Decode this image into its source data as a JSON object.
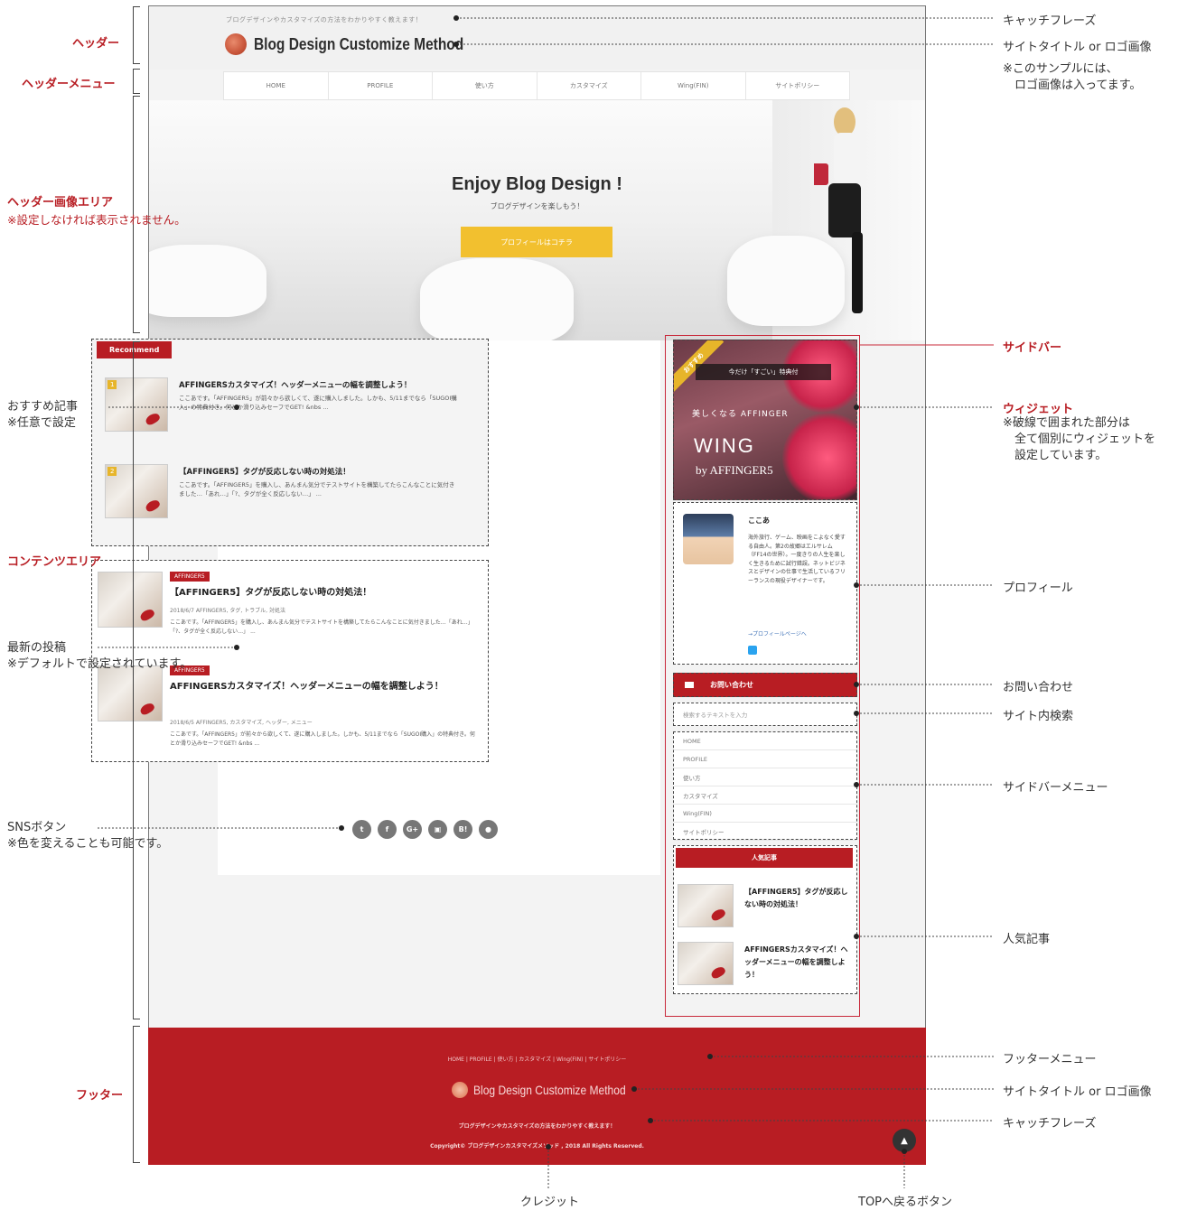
{
  "mock": {
    "catchphrase": "ブログデザインやカスタマイズの方法をわかりやすく教えます！",
    "site_title": "Blog Design Customize Method",
    "nav": [
      "HOME",
      "PROFILE",
      "使い方",
      "カスタマイズ",
      "Wing(FIN)",
      "サイトポリシー"
    ],
    "hero": {
      "title": "Enjoy Blog Design !",
      "subtitle": "ブログデザインを楽しもう！",
      "button": "プロフィールはコチラ"
    },
    "recommend": {
      "label": "Recommend",
      "items": [
        {
          "badge": "1",
          "title": "AFFINGERSカスタマイズ！ヘッダーメニューの幅を調整しよう！",
          "excerpt": "ここあです。「AFFINGER5」が前々から欲しくて、遂に購入しました。しかも、5/11までなら「SUGOI購入」の特典付き。何とか滑り込みセーフでGET! &nbs ..."
        },
        {
          "badge": "2",
          "title": "【AFFINGER5】タグが反応しない時の対処法！",
          "excerpt": "ここあです。「AFFINGER5」を購入し、あんまん気分でテストサイトを構築してたらこんなことに気付きました…「あれ…」「?、タグが全く反応しない…」 ..."
        }
      ]
    },
    "latest": [
      {
        "tag": "AFFINGER5",
        "title": "【AFFINGER5】タグが反応しない時の対処法！",
        "meta": "2018/6/7  AFFINGER5, タグ, トラブル, 対処法",
        "excerpt": "ここあです。「AFFINGER5」を購入し、あんまん気分でテストサイトを構築してたらこんなことに気付きました…「あれ…」「?、タグが全く反応しない…」 ..."
      },
      {
        "tag": "AFFINGER5",
        "title": "AFFINGERSカスタマイズ！ヘッダーメニューの幅を調整しよう！",
        "meta": "2018/6/5  AFFINGER5, カスタマイズ, ヘッダー, メニュー",
        "excerpt": "ここあです。「AFFINGER5」が前々から欲しくて、遂に購入しました。しかも、5/11までなら「SUGOI購入」の特典付き。何とか滑り込みセーフでGET! &nbs ..."
      }
    ],
    "sns": [
      "t",
      "f",
      "G+",
      "▣",
      "B!",
      "●"
    ],
    "wing": {
      "ribbon": "おすすめ",
      "head": "今だけ「すごい」特典付",
      "line": "美しくなる AFFINGER",
      "big": "WING",
      "by": "by AFFINGER5"
    },
    "profile": {
      "name": "ここあ",
      "bio": "海外旅行、ゲーム、映画をこよなく愛する自由人。第2の故郷はエルサレム（FF14の世界）。一度きりの人生を楽しく生きるために試行錯誤。ネットビジネスとデザインの仕事で生活しているフリーランスの現役デザイナーです。",
      "link": "→プロフィールページへ"
    },
    "contact": "お問い合わせ",
    "search_placeholder": "検索するテキストを入力",
    "side_menu": [
      "HOME",
      "PROFILE",
      "使い方",
      "カスタマイズ",
      "Wing(FIN)",
      "サイトポリシー"
    ],
    "popular": {
      "head": "人気記事",
      "items": [
        "【AFFINGER5】タグが反応しない時の対処法！",
        "AFFINGERSカスタマイズ！ヘッダーメニューの幅を調整しよう！"
      ]
    },
    "footer": {
      "menu": "HOME | PROFILE | 使い方 | カスタマイズ | Wing(FIN) | サイトポリシー",
      "site_title": "Blog Design Customize Method",
      "catchphrase": "ブログデザインやカスタマイズの方法をわかりやすく教えます！",
      "credit": "Copyright© ブログデザインカスタマイズメソッド , 2018 All Rights Reserved."
    },
    "to_top": "▲"
  },
  "annotations_left": {
    "header": "ヘッダー",
    "header_menu": "ヘッダーメニュー",
    "header_image_area": "ヘッダー画像エリア",
    "header_image_note": "※設定しなければ表示されません。",
    "recommend": "おすすめ記事\n※任意で設定",
    "content_area": "コンテンツエリア",
    "latest": "最新の投稿\n※デフォルトで設定されています。",
    "sns": "SNSボタン\n※色を変えることも可能です。",
    "footer": "フッター"
  },
  "annotations_right": {
    "catchphrase": "キャッチフレーズ",
    "site_title": "サイトタイトル or ロゴ画像",
    "logo_note": "※このサンプルには、\n　ロゴ画像は入ってます。",
    "sidebar": "サイドバー",
    "widget": "ウィジェット",
    "widget_note": "※破線で囲まれた部分は\n　全て個別にウィジェットを\n　設定しています。",
    "profile": "プロフィール",
    "contact": "お問い合わせ",
    "search": "サイト内検索",
    "side_menu": "サイドバーメニュー",
    "popular": "人気記事",
    "footer_menu": "フッターメニュー",
    "footer_site_title": "サイトタイトル or ロゴ画像",
    "footer_catchphrase": "キャッチフレーズ"
  },
  "annotations_bottom": {
    "credit": "クレジット",
    "top_button": "TOPへ戻るボタン"
  },
  "colors": {
    "accent_red": "#b81d23",
    "hero_button": "#f2c02f"
  }
}
